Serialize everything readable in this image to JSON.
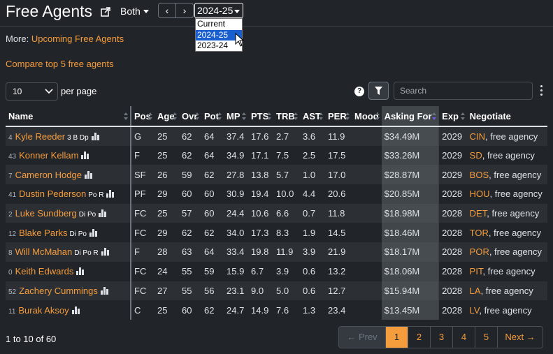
{
  "header": {
    "title": "Free Agents",
    "filter_label": "Both",
    "season_value": "2024-25",
    "prev_label": "‹",
    "next_label": "›",
    "season_options": [
      "Current",
      "2024-25",
      "2023-24"
    ]
  },
  "links": {
    "more_prefix": "More: ",
    "upcoming": "Upcoming Free Agents",
    "compare": "Compare top 5 free agents"
  },
  "controls": {
    "per_page_value": "10",
    "per_page_label": "per page",
    "help": "?",
    "search_placeholder": "Search"
  },
  "table": {
    "columns": [
      "Name",
      "Pos",
      "Age",
      "Ovr",
      "Pot",
      "MP",
      "PTS",
      "TRB",
      "AST",
      "PER",
      "Mood",
      "Asking For",
      "Exp",
      "Negotiate"
    ],
    "rows": [
      {
        "rank": "4",
        "name": "Kyle Reeder",
        "skills": "3 B Dp",
        "pos": "G",
        "age": "25",
        "ovr": "62",
        "pot": "64",
        "mp": "37.4",
        "pts": "17.6",
        "trb": "2.7",
        "ast": "3.6",
        "per": "11.9",
        "ask": "$34.49M",
        "exp": "2029",
        "team": "CIN",
        "neg": ", free agency"
      },
      {
        "rank": "43",
        "name": "Konner Kellam",
        "skills": "",
        "pos": "F",
        "age": "25",
        "ovr": "62",
        "pot": "64",
        "mp": "34.9",
        "pts": "17.1",
        "trb": "7.5",
        "ast": "2.5",
        "per": "17.5",
        "ask": "$33.26M",
        "exp": "2029",
        "team": "SD",
        "neg": ", free agency"
      },
      {
        "rank": "7",
        "name": "Cameron Hodge",
        "skills": "",
        "pos": "SF",
        "age": "26",
        "ovr": "59",
        "pot": "62",
        "mp": "27.8",
        "pts": "13.8",
        "trb": "5.7",
        "ast": "1.0",
        "per": "17.0",
        "ask": "$28.87M",
        "exp": "2029",
        "team": "BOS",
        "neg": ", free agency"
      },
      {
        "rank": "41",
        "name": "Dustin Pederson",
        "skills": "Po R",
        "pos": "PF",
        "age": "29",
        "ovr": "60",
        "pot": "60",
        "mp": "30.9",
        "pts": "19.4",
        "trb": "10.0",
        "ast": "4.4",
        "per": "20.6",
        "ask": "$20.85M",
        "exp": "2028",
        "team": "HOU",
        "neg": ", free agency"
      },
      {
        "rank": "2",
        "name": "Luke Sundberg",
        "skills": "Di Po",
        "pos": "FC",
        "age": "25",
        "ovr": "57",
        "pot": "60",
        "mp": "24.4",
        "pts": "10.6",
        "trb": "6.6",
        "ast": "0.7",
        "per": "11.8",
        "ask": "$18.98M",
        "exp": "2028",
        "team": "DET",
        "neg": ", free agency"
      },
      {
        "rank": "12",
        "name": "Blake Parks",
        "skills": "Di Po",
        "pos": "FC",
        "age": "29",
        "ovr": "62",
        "pot": "62",
        "mp": "34.0",
        "pts": "17.3",
        "trb": "8.3",
        "ast": "1.9",
        "per": "14.5",
        "ask": "$18.46M",
        "exp": "2028",
        "team": "TOR",
        "neg": ", free agency"
      },
      {
        "rank": "8",
        "name": "Will McMahan",
        "skills": "Di Po R",
        "pos": "F",
        "age": "28",
        "ovr": "63",
        "pot": "64",
        "mp": "33.4",
        "pts": "19.8",
        "trb": "11.9",
        "ast": "3.9",
        "per": "21.9",
        "ask": "$18.17M",
        "exp": "2028",
        "team": "POR",
        "neg": ", free agency"
      },
      {
        "rank": "0",
        "name": "Keith Edwards",
        "skills": "",
        "pos": "FC",
        "age": "24",
        "ovr": "55",
        "pot": "59",
        "mp": "15.9",
        "pts": "6.7",
        "trb": "3.9",
        "ast": "0.6",
        "per": "13.2",
        "ask": "$18.06M",
        "exp": "2028",
        "team": "PIT",
        "neg": ", free agency"
      },
      {
        "rank": "52",
        "name": "Zachery Cummings",
        "skills": "",
        "pos": "FC",
        "age": "27",
        "ovr": "55",
        "pot": "56",
        "mp": "23.1",
        "pts": "9.0",
        "trb": "5.0",
        "ast": "0.6",
        "per": "12.7",
        "ask": "$15.94M",
        "exp": "2028",
        "team": "LA",
        "neg": ", free agency"
      },
      {
        "rank": "11",
        "name": "Burak Aksoy",
        "skills": "",
        "pos": "C",
        "age": "25",
        "ovr": "60",
        "pot": "62",
        "mp": "24.7",
        "pts": "14.9",
        "trb": "7.6",
        "ast": "1.3",
        "per": "23.4",
        "ask": "$13.45M",
        "exp": "2028",
        "team": "LV",
        "neg": ", free agency"
      }
    ]
  },
  "footer": {
    "count": "1 to 10 of 60",
    "prev": "← Prev",
    "pages": [
      "1",
      "2",
      "3",
      "4",
      "5"
    ],
    "next": "Next →"
  },
  "colors": {
    "accent": "#f59c3d",
    "background": "#212529",
    "selected_option": "#1a5fd0"
  }
}
